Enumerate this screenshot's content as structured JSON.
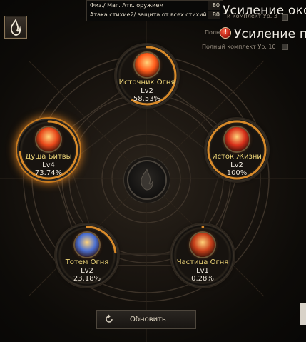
{
  "tooltip": {
    "rows": [
      {
        "label": "Физ./ Маг. Атк. оружием",
        "value": "80"
      },
      {
        "label": "Атака стихией/ защита от всех стихий",
        "value": "80"
      }
    ]
  },
  "side": {
    "title1": "Усиление окон",
    "title2": "Усиление пр",
    "note_top": "й комплект Ур. 3",
    "note_mid": "Полн",
    "note_bottom": "Полный комплект Ур. 10",
    "warn_glyph": "!"
  },
  "nodes": [
    {
      "id": "source",
      "name": "Источник Огня",
      "level": "Lv2",
      "percent": "58.53%",
      "progress": 0.5853,
      "active": false,
      "orb_color": "#ff5a1a"
    },
    {
      "id": "soul",
      "name": "Душа Битвы",
      "level": "Lv4",
      "percent": "73.74%",
      "progress": 0.7374,
      "active": true,
      "orb_color": "#e8481a"
    },
    {
      "id": "life",
      "name": "Исток Жизни",
      "level": "Lv2",
      "percent": "100%",
      "progress": 1.0,
      "active": false,
      "orb_color": "#d8301a"
    },
    {
      "id": "totem",
      "name": "Тотем Огня",
      "level": "Lv2",
      "percent": "23.18%",
      "progress": 0.2318,
      "active": false,
      "orb_color": "#4a6fd0"
    },
    {
      "id": "particle",
      "name": "Частица Огня",
      "level": "Lv1",
      "percent": "0.28%",
      "progress": 0.0028,
      "active": false,
      "orb_color": "#c8401a"
    }
  ],
  "refresh_label": "Обновить",
  "colors": {
    "accent": "#c77a1f",
    "progress": "#d88a2a",
    "name_text": "#f1d87a"
  }
}
